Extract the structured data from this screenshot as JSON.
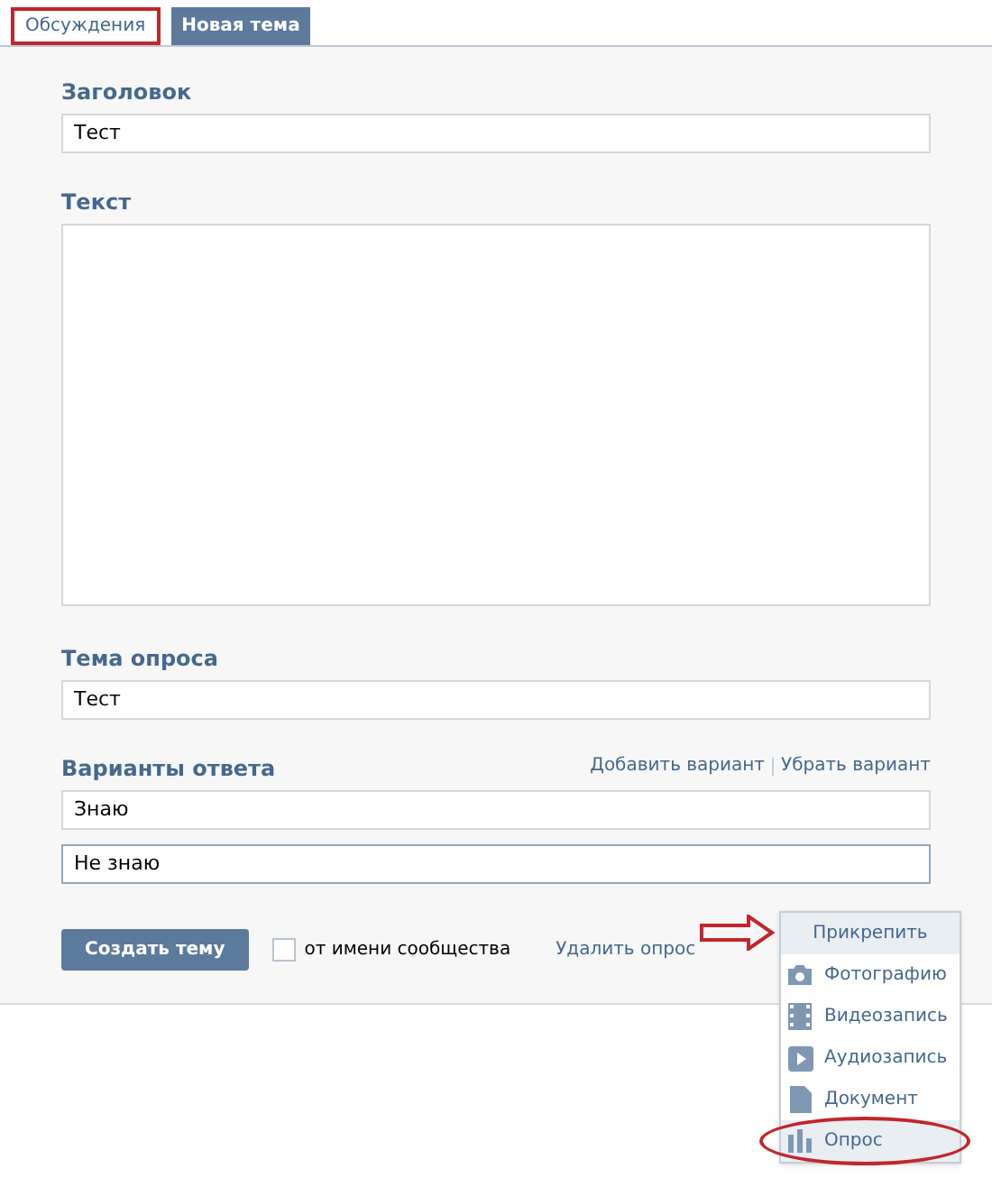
{
  "tabs": [
    {
      "label": "Обсуждения",
      "selected": false,
      "circled": true
    },
    {
      "label": "Новая тема",
      "selected": true,
      "circled": false
    }
  ],
  "title_field": {
    "label": "Заголовок",
    "value": "Тест"
  },
  "text_field": {
    "label": "Текст"
  },
  "poll": {
    "label": "Тема опроса",
    "value": "Тест"
  },
  "answers": {
    "label": "Варианты ответа",
    "add_link": "Добавить вариант",
    "remove_link": "Убрать вариант",
    "options": [
      {
        "value": "Знаю",
        "focused": false
      },
      {
        "value": "Не знаю",
        "focused": true
      }
    ]
  },
  "footer": {
    "submit": "Создать тему",
    "community_checkbox": {
      "label": "от имени сообщества",
      "checked": false
    },
    "delete_poll": "Удалить опрос"
  },
  "attach_menu": {
    "title": "Прикрепить",
    "pointed": true,
    "items": [
      {
        "kind": "photo",
        "label": "Фотографию",
        "selected": false
      },
      {
        "kind": "video",
        "label": "Видеозапись",
        "selected": false
      },
      {
        "kind": "audio",
        "label": "Аудиозапись",
        "selected": false
      },
      {
        "kind": "document",
        "label": "Документ",
        "selected": false
      },
      {
        "kind": "poll",
        "label": "Опрос",
        "selected": true
      }
    ]
  }
}
